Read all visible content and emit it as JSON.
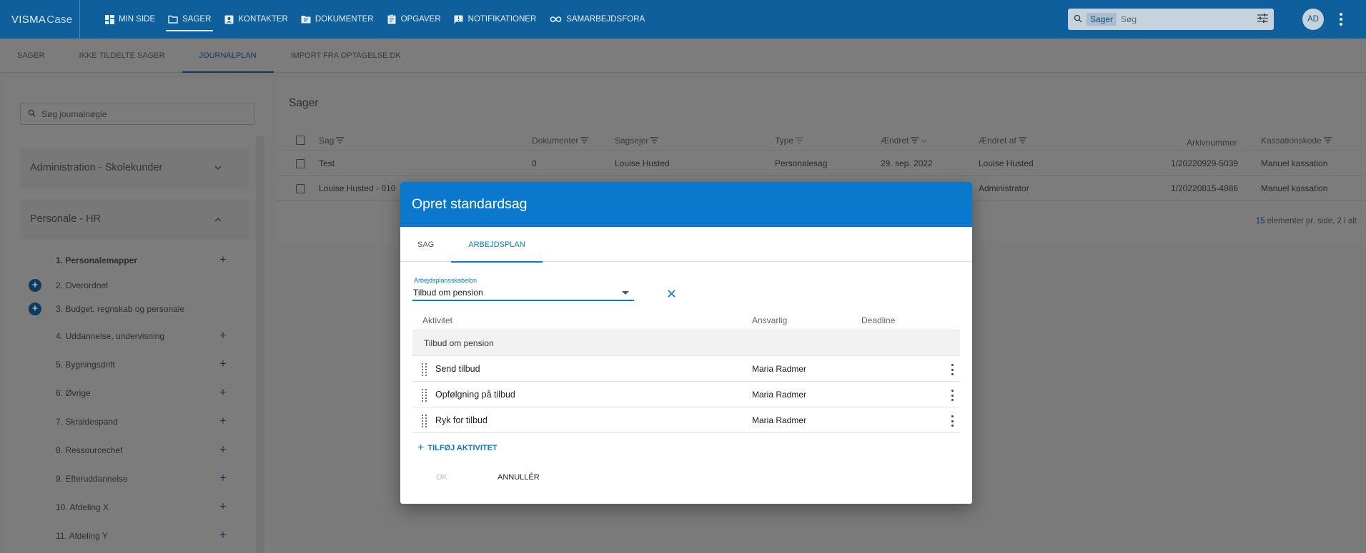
{
  "topbar": {
    "brand_main": "VISMA",
    "brand_sub": "Case",
    "nav": [
      {
        "label": "Min side",
        "icon": "dashboard-icon"
      },
      {
        "label": "Sager",
        "icon": "folder-icon"
      },
      {
        "label": "Kontakter",
        "icon": "contact-card-icon"
      },
      {
        "label": "Dokumenter",
        "icon": "document-folder-icon"
      },
      {
        "label": "Opgaver",
        "icon": "clipboard-icon"
      },
      {
        "label": "Notifikationer",
        "icon": "chat-notification-icon"
      },
      {
        "label": "Samarbejdsfora",
        "icon": "infinity-icon"
      }
    ],
    "active_nav": "Sager",
    "search_chip": "Sager",
    "search_placeholder": "Søg",
    "avatar_initials": "AD"
  },
  "subnav": {
    "tabs": [
      "Sager",
      "Ikke tildelte sager",
      "Journalplan",
      "Import fra optagelse.dk"
    ],
    "active": "Journalplan"
  },
  "left": {
    "search_placeholder": "Søg journalnøgle",
    "sections": [
      {
        "label": "Administration - Skolekunder"
      },
      {
        "label": "Personale - HR"
      }
    ],
    "items": [
      {
        "label": "1. Personalemapper"
      },
      {
        "label": "2. Overordnet"
      },
      {
        "label": "3. Budget, regnskab og personale"
      },
      {
        "label": "4. Uddannelse, undervisning"
      },
      {
        "label": "5. Bygningsdrift"
      },
      {
        "label": "6. Øvrige"
      },
      {
        "label": "7. Skraldespand"
      },
      {
        "label": "8. Ressourcechef"
      },
      {
        "label": "9. Efteruddannelse"
      },
      {
        "label": "10. Afdeling X"
      },
      {
        "label": "11. Afdeling Y"
      }
    ]
  },
  "cases": {
    "title": "Sager",
    "columns": {
      "sag": "Sag",
      "dokumenter": "Dokumenter",
      "sagsejer": "Sagsejer",
      "type": "Type",
      "aendret": "Ændret",
      "aendret_af": "Ændret af",
      "arkivnummer": "Arkivnummer",
      "kassationskode": "Kassationskode"
    },
    "rows": [
      {
        "sag": "Test",
        "dokumenter": "0",
        "sagsejer": "Louise Husted",
        "type": "Personalesag",
        "aendret": "29. sep. 2022",
        "aendret_af": "Louise Husted",
        "arkivnummer": "1/20220929-5039",
        "kassationskode": "Manuel kassation"
      },
      {
        "sag": "Louise Husted - 010",
        "dokumenter": "",
        "sagsejer": "",
        "type": "",
        "aendret": "",
        "aendret_af": "Administrator",
        "arkivnummer": "1/20220815-4886",
        "kassationskode": "Manuel kassation"
      }
    ],
    "pager_count": "15",
    "pager_text": "elementer pr. side, 2 i alt"
  },
  "dialog": {
    "title": "Opret standardsag",
    "tabs": [
      "Sag",
      "Arbejdsplan"
    ],
    "active_tab": "Arbejdsplan",
    "template_label": "Arbejdsplansskabelon",
    "template_value": "Tilbud om pension",
    "columns": {
      "aktivitet": "Aktivitet",
      "ansvarlig": "Ansvarlig",
      "deadline": "Deadline"
    },
    "group": "Tilbud om pension",
    "activities": [
      {
        "name": "Send tilbud",
        "responsible": "Maria Radmer",
        "deadline": ""
      },
      {
        "name": "Opfølgning på tilbud",
        "responsible": "Maria Radmer",
        "deadline": ""
      },
      {
        "name": "Ryk for tilbud",
        "responsible": "Maria Radmer",
        "deadline": ""
      }
    ],
    "add_activity": "Tilføj aktivitet",
    "ok": "OK",
    "cancel": "Annullér"
  },
  "colors": {
    "topbar": "#0e5f9c",
    "dialog_header": "#0a78cc",
    "accent": "#0a78cc"
  }
}
